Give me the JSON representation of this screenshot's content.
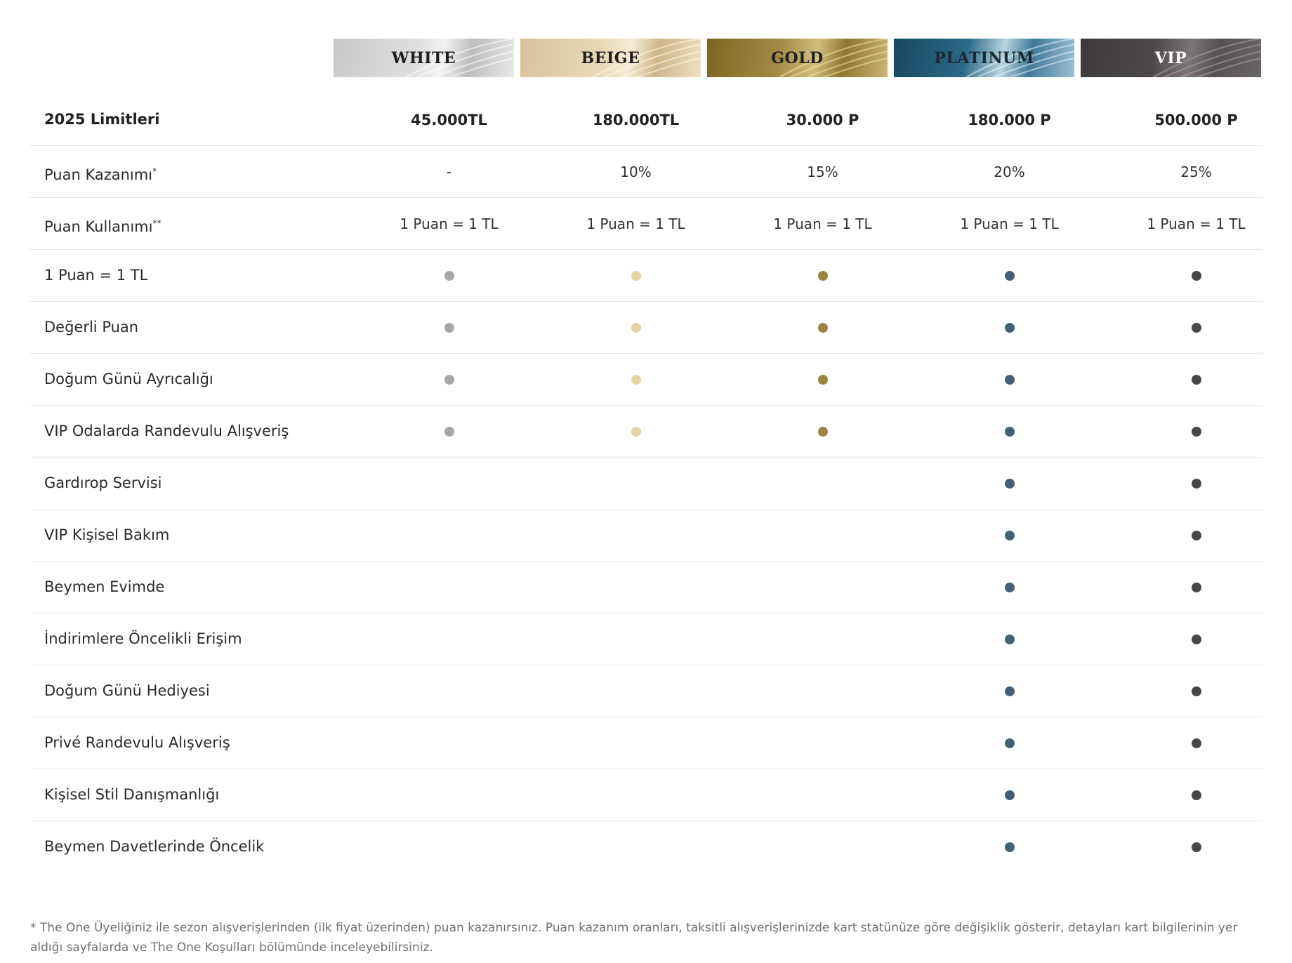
{
  "tiers": [
    {
      "name": "WHITE",
      "dot_color": "#a7a7a7"
    },
    {
      "name": "BEIGE",
      "dot_color": "#e6d3a3"
    },
    {
      "name": "GOLD",
      "dot_color": "#9c8443"
    },
    {
      "name": "PLATINUM",
      "dot_color": "#3f6278"
    },
    {
      "name": "VIP",
      "dot_color": "#4a4646"
    }
  ],
  "limits_row": {
    "label": "2025 Limitleri",
    "values": [
      "45.000TL",
      "180.000TL",
      "30.000 P",
      "180.000 P",
      "500.000 P"
    ]
  },
  "earn_row": {
    "label": "Puan Kazanımı",
    "mark": "*",
    "values": [
      "-",
      "10%",
      "15%",
      "20%",
      "25%"
    ]
  },
  "use_row": {
    "label": "Puan Kullanımı",
    "mark": "**",
    "values": [
      "1 Puan = 1 TL",
      "1 Puan = 1 TL",
      "1 Puan = 1 TL",
      "1 Puan = 1 TL",
      "1 Puan = 1 TL"
    ]
  },
  "benefits": [
    {
      "label": "1 Puan = 1 TL",
      "available": [
        true,
        true,
        true,
        true,
        true
      ]
    },
    {
      "label": "Değerli Puan",
      "available": [
        true,
        true,
        true,
        true,
        true
      ]
    },
    {
      "label": "Doğum Günü Ayrıcalığı",
      "available": [
        true,
        true,
        true,
        true,
        true
      ]
    },
    {
      "label": "VIP Odalarda Randevulu Alışveriş",
      "available": [
        true,
        true,
        true,
        true,
        true
      ]
    },
    {
      "label": "Gardırop Servisi",
      "available": [
        false,
        false,
        false,
        true,
        true
      ]
    },
    {
      "label": "VIP Kişisel Bakım",
      "available": [
        false,
        false,
        false,
        true,
        true
      ]
    },
    {
      "label": "Beymen Evimde",
      "available": [
        false,
        false,
        false,
        true,
        true
      ]
    },
    {
      "label": "İndirimlere Öncelikli Erişim",
      "available": [
        false,
        false,
        false,
        true,
        true
      ]
    },
    {
      "label": "Doğum Günü Hediyesi",
      "available": [
        false,
        false,
        false,
        true,
        true
      ]
    },
    {
      "label": "Privé Randevulu Alışveriş",
      "available": [
        false,
        false,
        false,
        true,
        true
      ]
    },
    {
      "label": "Kişisel Stil Danışmanlığı",
      "available": [
        false,
        false,
        false,
        true,
        true
      ]
    },
    {
      "label": "Beymen Davetlerinde Öncelik",
      "available": [
        false,
        false,
        false,
        true,
        true
      ]
    }
  ],
  "footnote": "* The One Üyeliğiniz ile sezon alışverişlerinden (ilk fiyat üzerinden) puan kazanırsınız. Puan kazanım oranları, taksitli alışverişlerinizde kart statünüze göre değişiklik gösterir, detayları kart bilgilerinin yer aldığı sayfalarda ve The One Koşulları bölümünde inceleyebilirsiniz."
}
